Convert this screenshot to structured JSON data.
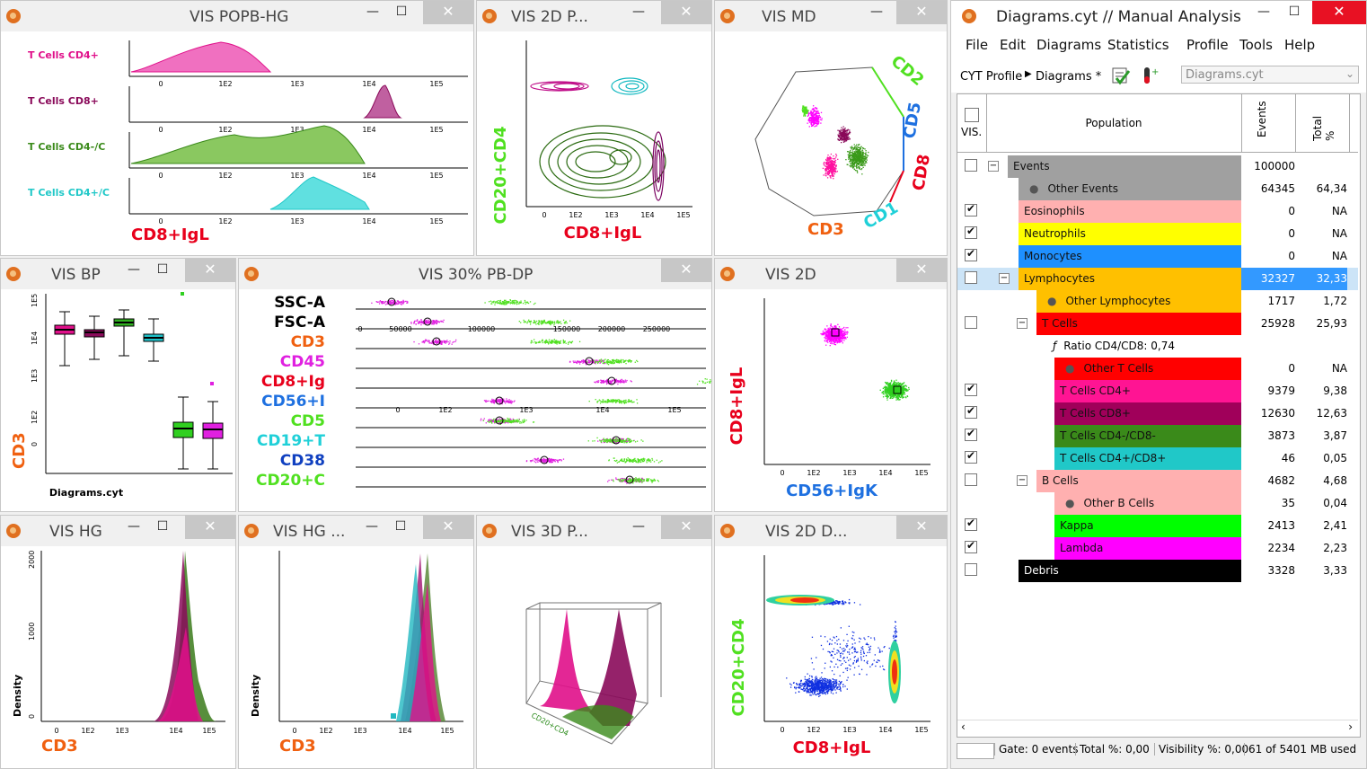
{
  "windows": {
    "w1": {
      "title": "VIS POPB-HG",
      "xlabel": "CD8+IgL",
      "rows": [
        "T Cells CD4+",
        "T Cells CD8+",
        "T Cells CD4-/C",
        "T Cells CD4+/C"
      ],
      "ticks": [
        "0",
        "1E2",
        "1E3",
        "1E4",
        "1E5"
      ]
    },
    "w2": {
      "title": "VIS 2D P...",
      "xlabel": "CD8+IgL",
      "ylabel": "CD20+CD4"
    },
    "w3": {
      "title": "VIS MD",
      "axes": [
        "CD2",
        "CD5",
        "CD8",
        "CD1",
        "CD3"
      ]
    },
    "w4": {
      "title": "VIS BP",
      "ylabel": "CD3",
      "xlabel": "Diagrams.cyt"
    },
    "w5": {
      "title": "VIS 30% PB-DP",
      "labels": [
        "SSC-A",
        "FSC-A",
        "CD3",
        "CD45",
        "CD8+Ig",
        "CD56+I",
        "CD5",
        "CD19+T",
        "CD38",
        "CD20+C"
      ],
      "lin_ticks": [
        "0",
        "50000",
        "100000",
        "150000",
        "200000",
        "250000"
      ]
    },
    "w6": {
      "title": "VIS 2D",
      "xlabel": "CD56+IgK",
      "ylabel": "CD8+IgL"
    },
    "w7": {
      "title": "VIS HG",
      "xlabel": "CD3",
      "ylabel": "Density",
      "yticks": [
        "2000",
        "1000",
        "0"
      ]
    },
    "w8": {
      "title": "VIS HG ...",
      "xlabel": "CD3",
      "ylabel": "Density"
    },
    "w9": {
      "title": "VIS 3D P..."
    },
    "w10": {
      "title": "VIS 2D D...",
      "xlabel": "CD8+IgL",
      "ylabel": "CD20+CD4"
    }
  },
  "log_ticks": [
    "0",
    "1E2",
    "1E3",
    "1E4",
    "1E5"
  ],
  "manager": {
    "title": "Diagrams.cyt // Manual Analysis",
    "menu": [
      "File",
      "Edit",
      "Diagrams",
      "Statistics",
      "Profile",
      "Tools",
      "Help"
    ],
    "crumb_profile": "CYT Profile",
    "crumb_diagrams": "Diagrams *",
    "file_select": "Diagrams.cyt",
    "col_vis": "VIS.",
    "col_population": "Population",
    "col_events": "Events",
    "col_total": "Total %",
    "rows": [
      {
        "name": "Events",
        "events": "100000",
        "total": "",
        "color": "#a0a0a0",
        "indent": 56,
        "checked": false,
        "expander": "−"
      },
      {
        "name": "Other Events",
        "events": "64345",
        "total": "64,34",
        "color": "#a0a0a0",
        "indent": 68,
        "checked": null,
        "bullet": true
      },
      {
        "name": "Eosinophils",
        "events": "0",
        "total": "NA",
        "color": "#ffb0b0",
        "indent": 68,
        "checked": true
      },
      {
        "name": "Neutrophils",
        "events": "0",
        "total": "NA",
        "color": "#ffff00",
        "indent": 68,
        "checked": true
      },
      {
        "name": "Monocytes",
        "events": "0",
        "total": "NA",
        "color": "#1e90ff",
        "indent": 68,
        "checked": true
      },
      {
        "name": "Lymphocytes",
        "events": "32327",
        "total": "32,33",
        "color": "#ffc000",
        "indent": 68,
        "checked": false,
        "expander": "−",
        "selected": true
      },
      {
        "name": "Other Lymphocytes",
        "events": "1717",
        "total": "1,72",
        "color": "#ffc000",
        "indent": 88,
        "checked": null,
        "bullet": true
      },
      {
        "name": "T Cells",
        "events": "25928",
        "total": "25,93",
        "color": "#ff0000",
        "indent": 88,
        "checked": false,
        "expander": "−"
      },
      {
        "name": "Ratio CD4/CD8: 0,74",
        "events": "",
        "total": "",
        "color": "",
        "indent": 108,
        "checked": null,
        "func": true
      },
      {
        "name": "Other T Cells",
        "events": "0",
        "total": "NA",
        "color": "#ff0000",
        "indent": 108,
        "checked": null,
        "bullet": true
      },
      {
        "name": "T Cells CD4+",
        "events": "9379",
        "total": "9,38",
        "color": "#ff1493",
        "indent": 108,
        "checked": true
      },
      {
        "name": "T Cells CD8+",
        "events": "12630",
        "total": "12,63",
        "color": "#a0005a",
        "indent": 108,
        "checked": true
      },
      {
        "name": "T Cells CD4-/CD8-",
        "events": "3873",
        "total": "3,87",
        "color": "#3a8a1a",
        "indent": 108,
        "checked": true
      },
      {
        "name": "T Cells CD4+/CD8+",
        "events": "46",
        "total": "0,05",
        "color": "#20c8c8",
        "indent": 108,
        "checked": true
      },
      {
        "name": "B Cells",
        "events": "4682",
        "total": "4,68",
        "color": "#ffb0b0",
        "indent": 88,
        "checked": false,
        "expander": "−"
      },
      {
        "name": "Other B Cells",
        "events": "35",
        "total": "0,04",
        "color": "#ffb0b0",
        "indent": 108,
        "checked": null,
        "bullet": true
      },
      {
        "name": "Kappa",
        "events": "2413",
        "total": "2,41",
        "color": "#00ff00",
        "indent": 108,
        "checked": true
      },
      {
        "name": "Lambda",
        "events": "2234",
        "total": "2,23",
        "color": "#ff00ff",
        "indent": 108,
        "checked": true
      },
      {
        "name": "Debris",
        "events": "3328",
        "total": "3,33",
        "color": "#000000",
        "indent": 68,
        "checked": false,
        "textcolor": "#ffffff"
      }
    ],
    "status": [
      "Gate: 0 events",
      "Total %: 0,00",
      "Visibility %: 0,00",
      "61 of 5401 MB used"
    ]
  }
}
